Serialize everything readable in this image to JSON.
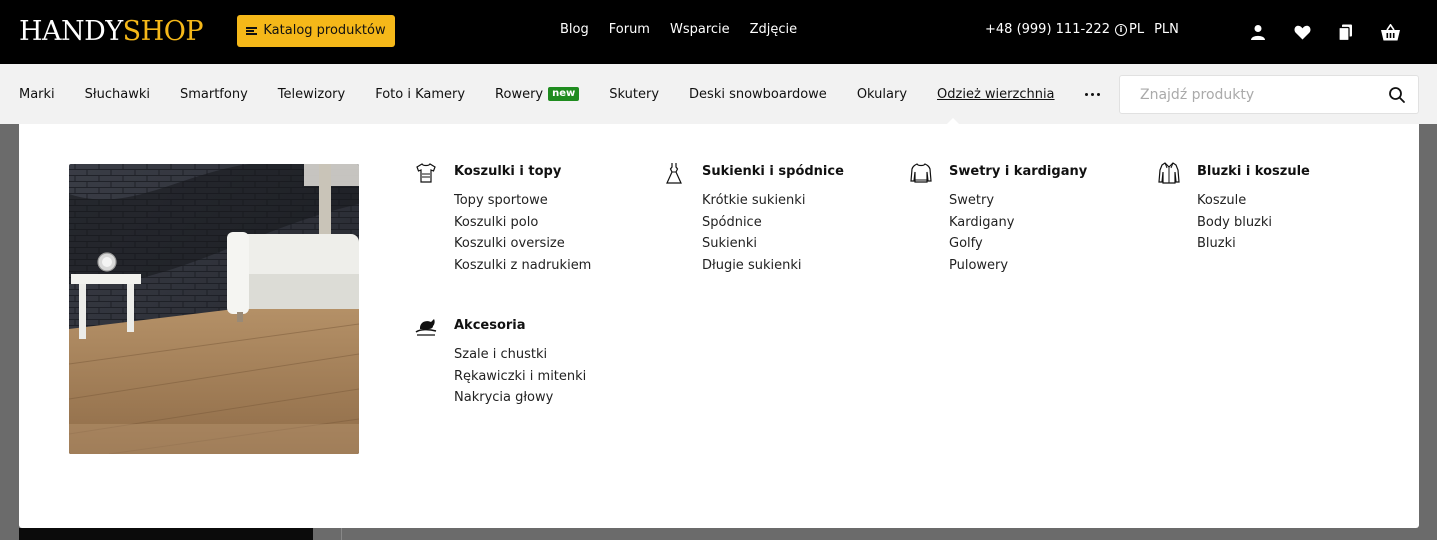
{
  "header": {
    "logo_part1": "HANDY",
    "logo_part2": "SHOP",
    "catalog_button": "Katalog produktów",
    "nav": [
      "Blog",
      "Forum",
      "Wsparcie",
      "Zdjęcie"
    ],
    "phone": "+48 (999) 111-222",
    "language": "PL",
    "currency": "PLN",
    "icons": [
      "user-icon",
      "heart-icon",
      "compare-icon",
      "basket-icon"
    ]
  },
  "categories": {
    "items": [
      {
        "label": "Marki"
      },
      {
        "label": "Słuchawki"
      },
      {
        "label": "Smartfony"
      },
      {
        "label": "Telewizory"
      },
      {
        "label": "Foto i Kamery"
      },
      {
        "label": "Rowery",
        "badge": "new"
      },
      {
        "label": "Skutery"
      },
      {
        "label": "Deski snowboardowe"
      },
      {
        "label": "Okulary"
      },
      {
        "label": "Odzież wierzchnia",
        "active": true
      }
    ],
    "search_placeholder": "Znajdź produkty"
  },
  "mega_menu": {
    "columns": [
      {
        "title": "Koszulki i topy",
        "icon": "tshirt-icon",
        "links": [
          "Topy sportowe",
          "Koszulki polo",
          "Koszulki oversize",
          "Koszulki z nadrukiem"
        ]
      },
      {
        "title": "Sukienki i spódnice",
        "icon": "dress-icon",
        "links": [
          "Krótkie sukienki",
          "Spódnice",
          "Sukienki",
          "Długie sukienki"
        ]
      },
      {
        "title": "Swetry i kardigany",
        "icon": "sweater-icon",
        "links": [
          "Swetry",
          "Kardigany",
          "Golfy",
          "Pulowery"
        ]
      },
      {
        "title": "Bluzki i koszule",
        "icon": "shirt-icon",
        "links": [
          "Koszule",
          "Body bluzki",
          "Bluzki"
        ]
      },
      {
        "title": "Akcesoria",
        "icon": "hat-icon",
        "links": [
          "Szale i chustki",
          "Rękawiczki i mitenki",
          "Nakrycia głowy"
        ]
      }
    ]
  },
  "colors": {
    "accent": "#f5b819",
    "header_bg": "#000000",
    "badge_green": "#1f8c1f"
  }
}
